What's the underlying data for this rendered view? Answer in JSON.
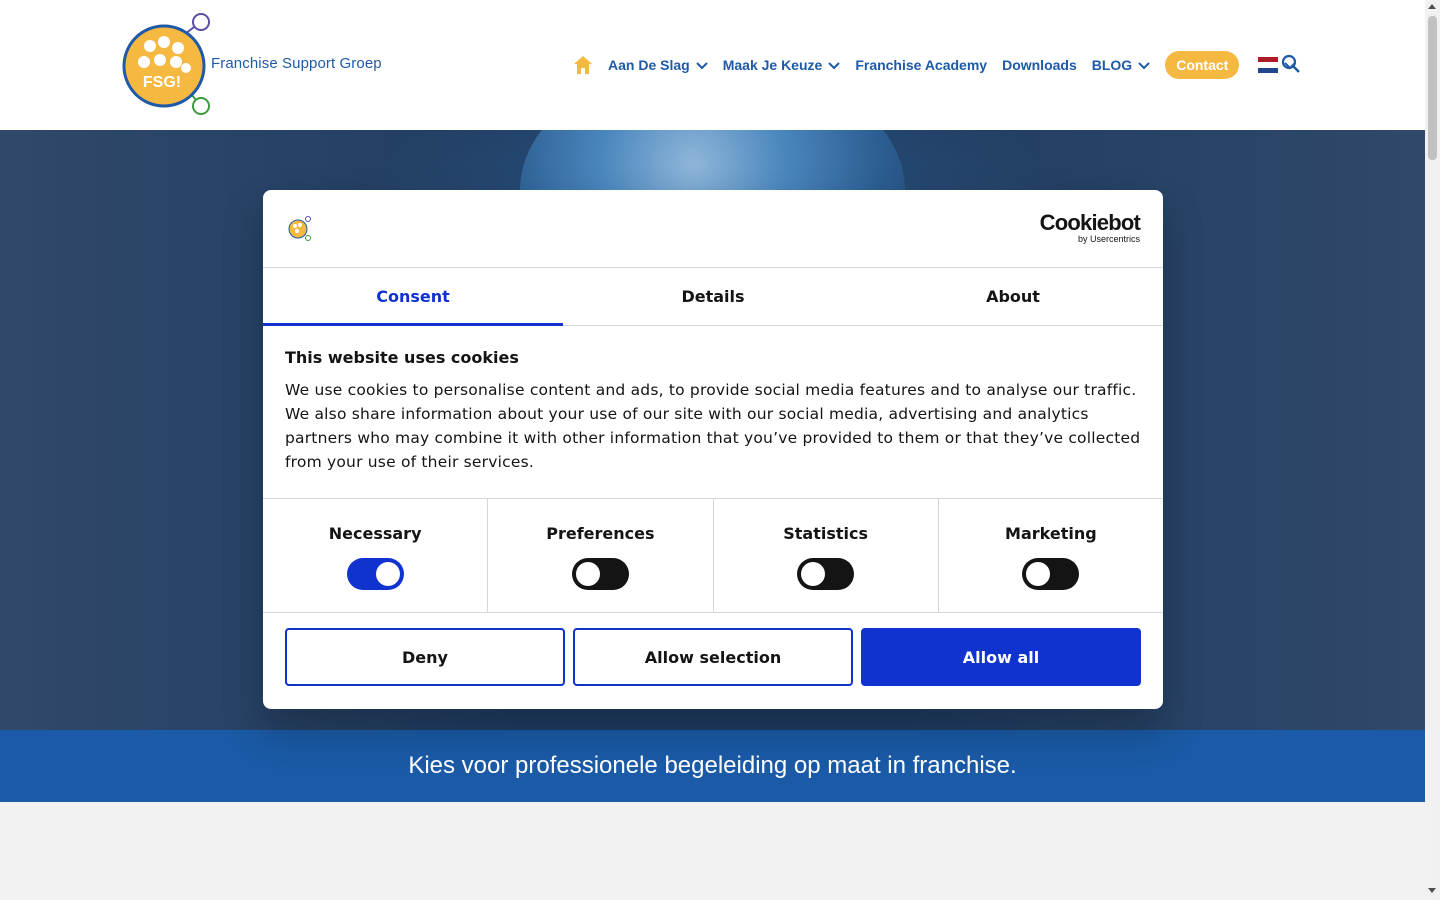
{
  "site": {
    "brand_name": "Franchise Support Groep",
    "logo_text": "FSG!"
  },
  "nav": {
    "items": [
      {
        "label": "Aan De Slag",
        "has_dropdown": true
      },
      {
        "label": "Maak Je Keuze",
        "has_dropdown": true
      },
      {
        "label": "Franchise Academy",
        "has_dropdown": false
      },
      {
        "label": "Downloads",
        "has_dropdown": false
      },
      {
        "label": "BLOG",
        "has_dropdown": true
      }
    ],
    "contact_label": "Contact",
    "icons": [
      "home-icon",
      "flag-nl-icon",
      "chevron-down-icon",
      "search-icon"
    ]
  },
  "hero": {
    "tagline": "Kies voor professionele begeleiding op maat in franchise."
  },
  "cookie_dialog": {
    "provider_name": "Cookiebot",
    "provider_sub": "by Usercentrics",
    "tabs": [
      {
        "label": "Consent",
        "active": true
      },
      {
        "label": "Details",
        "active": false
      },
      {
        "label": "About",
        "active": false
      }
    ],
    "title": "This website uses cookies",
    "body": "We use cookies to personalise content and ads, to provide social media features and to analyse our traffic. We also share information about your use of our site with our social media, advertising and analytics partners who may combine it with other information that you’ve provided to them or that they’ve collected from your use of their services.",
    "toggles": [
      {
        "label": "Necessary",
        "on": true
      },
      {
        "label": "Preferences",
        "on": false
      },
      {
        "label": "Statistics",
        "on": false
      },
      {
        "label": "Marketing",
        "on": false
      }
    ],
    "buttons": {
      "deny": "Deny",
      "allow_selection": "Allow selection",
      "allow_all": "Allow all"
    }
  },
  "colors": {
    "brand_blue": "#1e5aa8",
    "accent_orange": "#f5b942",
    "cookiebot_blue": "#1032cf",
    "tagline_bar": "#1a5aa6"
  }
}
